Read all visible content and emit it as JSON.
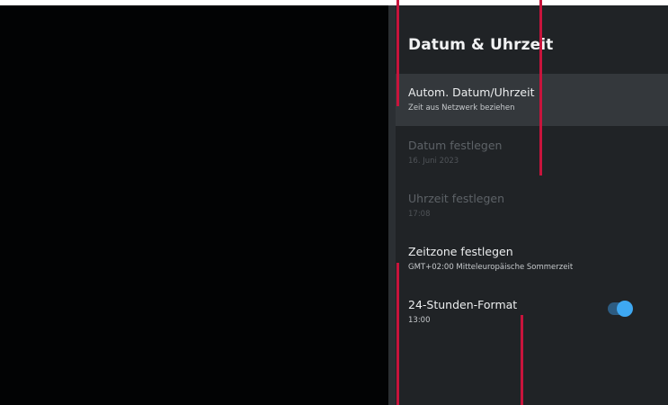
{
  "settings": {
    "title": "Datum & Uhrzeit",
    "items": [
      {
        "label": "Autom. Datum/Uhrzeit",
        "sub": "Zeit aus Netzwerk beziehen",
        "focused": true,
        "enabled": true
      },
      {
        "label": "Datum festlegen",
        "sub": "16. Juni 2023",
        "focused": false,
        "enabled": false
      },
      {
        "label": "Uhrzeit festlegen",
        "sub": "17:08",
        "focused": false,
        "enabled": false
      },
      {
        "label": "Zeitzone festlegen",
        "sub": "GMT+02:00 Mitteleuropäische Sommerzeit",
        "focused": false,
        "enabled": true
      },
      {
        "label": "24-Stunden-Format",
        "sub": "13:00",
        "focused": false,
        "enabled": true,
        "toggle_on": true
      }
    ]
  },
  "colors": {
    "panel_bg": "#202326",
    "focus_bg": "#34383c",
    "toggle_on": "#3ea8f2",
    "marker": "#c8143c"
  }
}
